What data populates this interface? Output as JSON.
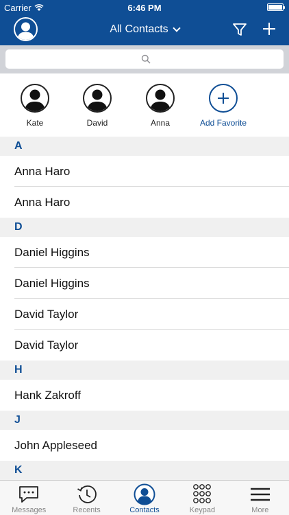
{
  "status_bar": {
    "carrier": "Carrier",
    "time": "6:46 PM",
    "battery_level": 1.0
  },
  "nav": {
    "title": "All Contacts",
    "profile_icon": "avatar-icon",
    "filter_icon": "filter-icon",
    "add_icon": "plus-icon"
  },
  "search": {
    "placeholder": "",
    "value": ""
  },
  "favorites": [
    {
      "name": "Kate"
    },
    {
      "name": "David"
    },
    {
      "name": "Anna"
    }
  ],
  "add_favorite_label": "Add Favorite",
  "sections": [
    {
      "letter": "A",
      "contacts": [
        "Anna Haro",
        "Anna Haro"
      ]
    },
    {
      "letter": "D",
      "contacts": [
        "Daniel Higgins",
        "Daniel Higgins",
        "David Taylor",
        "David Taylor"
      ]
    },
    {
      "letter": "H",
      "contacts": [
        "Hank Zakroff"
      ]
    },
    {
      "letter": "J",
      "contacts": [
        "John Appleseed"
      ]
    },
    {
      "letter": "K",
      "contacts": []
    }
  ],
  "tabs": [
    {
      "label": "Messages",
      "icon": "messages-icon",
      "active": false
    },
    {
      "label": "Recents",
      "icon": "recents-icon",
      "active": false
    },
    {
      "label": "Contacts",
      "icon": "contacts-icon",
      "active": true
    },
    {
      "label": "Keypad",
      "icon": "keypad-icon",
      "active": false
    },
    {
      "label": "More",
      "icon": "more-icon",
      "active": false
    }
  ],
  "colors": {
    "brand": "#0f4e95",
    "section_bg": "#f0f0f0",
    "tab_inactive": "#888888"
  }
}
